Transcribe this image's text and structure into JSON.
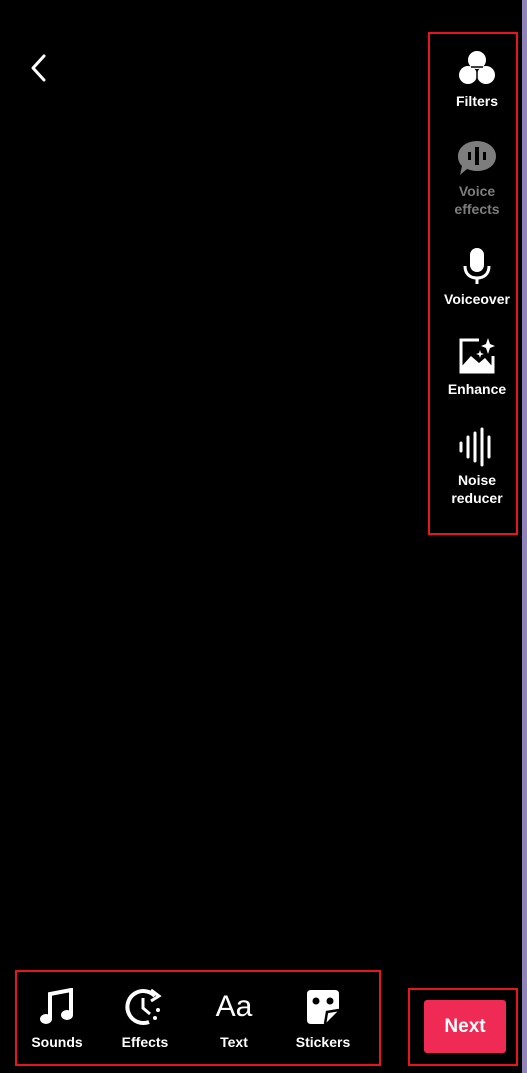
{
  "side_tools": [
    {
      "label": "Filters",
      "icon": "filters-icon",
      "enabled": true
    },
    {
      "label": "Voice\neffects",
      "icon": "voice-effects-icon",
      "enabled": false
    },
    {
      "label": "Voiceover",
      "icon": "microphone-icon",
      "enabled": true
    },
    {
      "label": "Enhance",
      "icon": "enhance-icon",
      "enabled": true
    },
    {
      "label": "Noise\nreducer",
      "icon": "noise-reducer-icon",
      "enabled": true
    }
  ],
  "bottom_tools": [
    {
      "label": "Sounds",
      "icon": "music-note-icon"
    },
    {
      "label": "Effects",
      "icon": "effects-icon"
    },
    {
      "label": "Text",
      "icon": "text-icon",
      "glyph": "Aa"
    },
    {
      "label": "Stickers",
      "icon": "sticker-icon"
    }
  ],
  "next_label": "Next",
  "colors": {
    "accent": "#ee2a55",
    "highlight": "#e5161f",
    "disabled": "#7d7d7d"
  }
}
